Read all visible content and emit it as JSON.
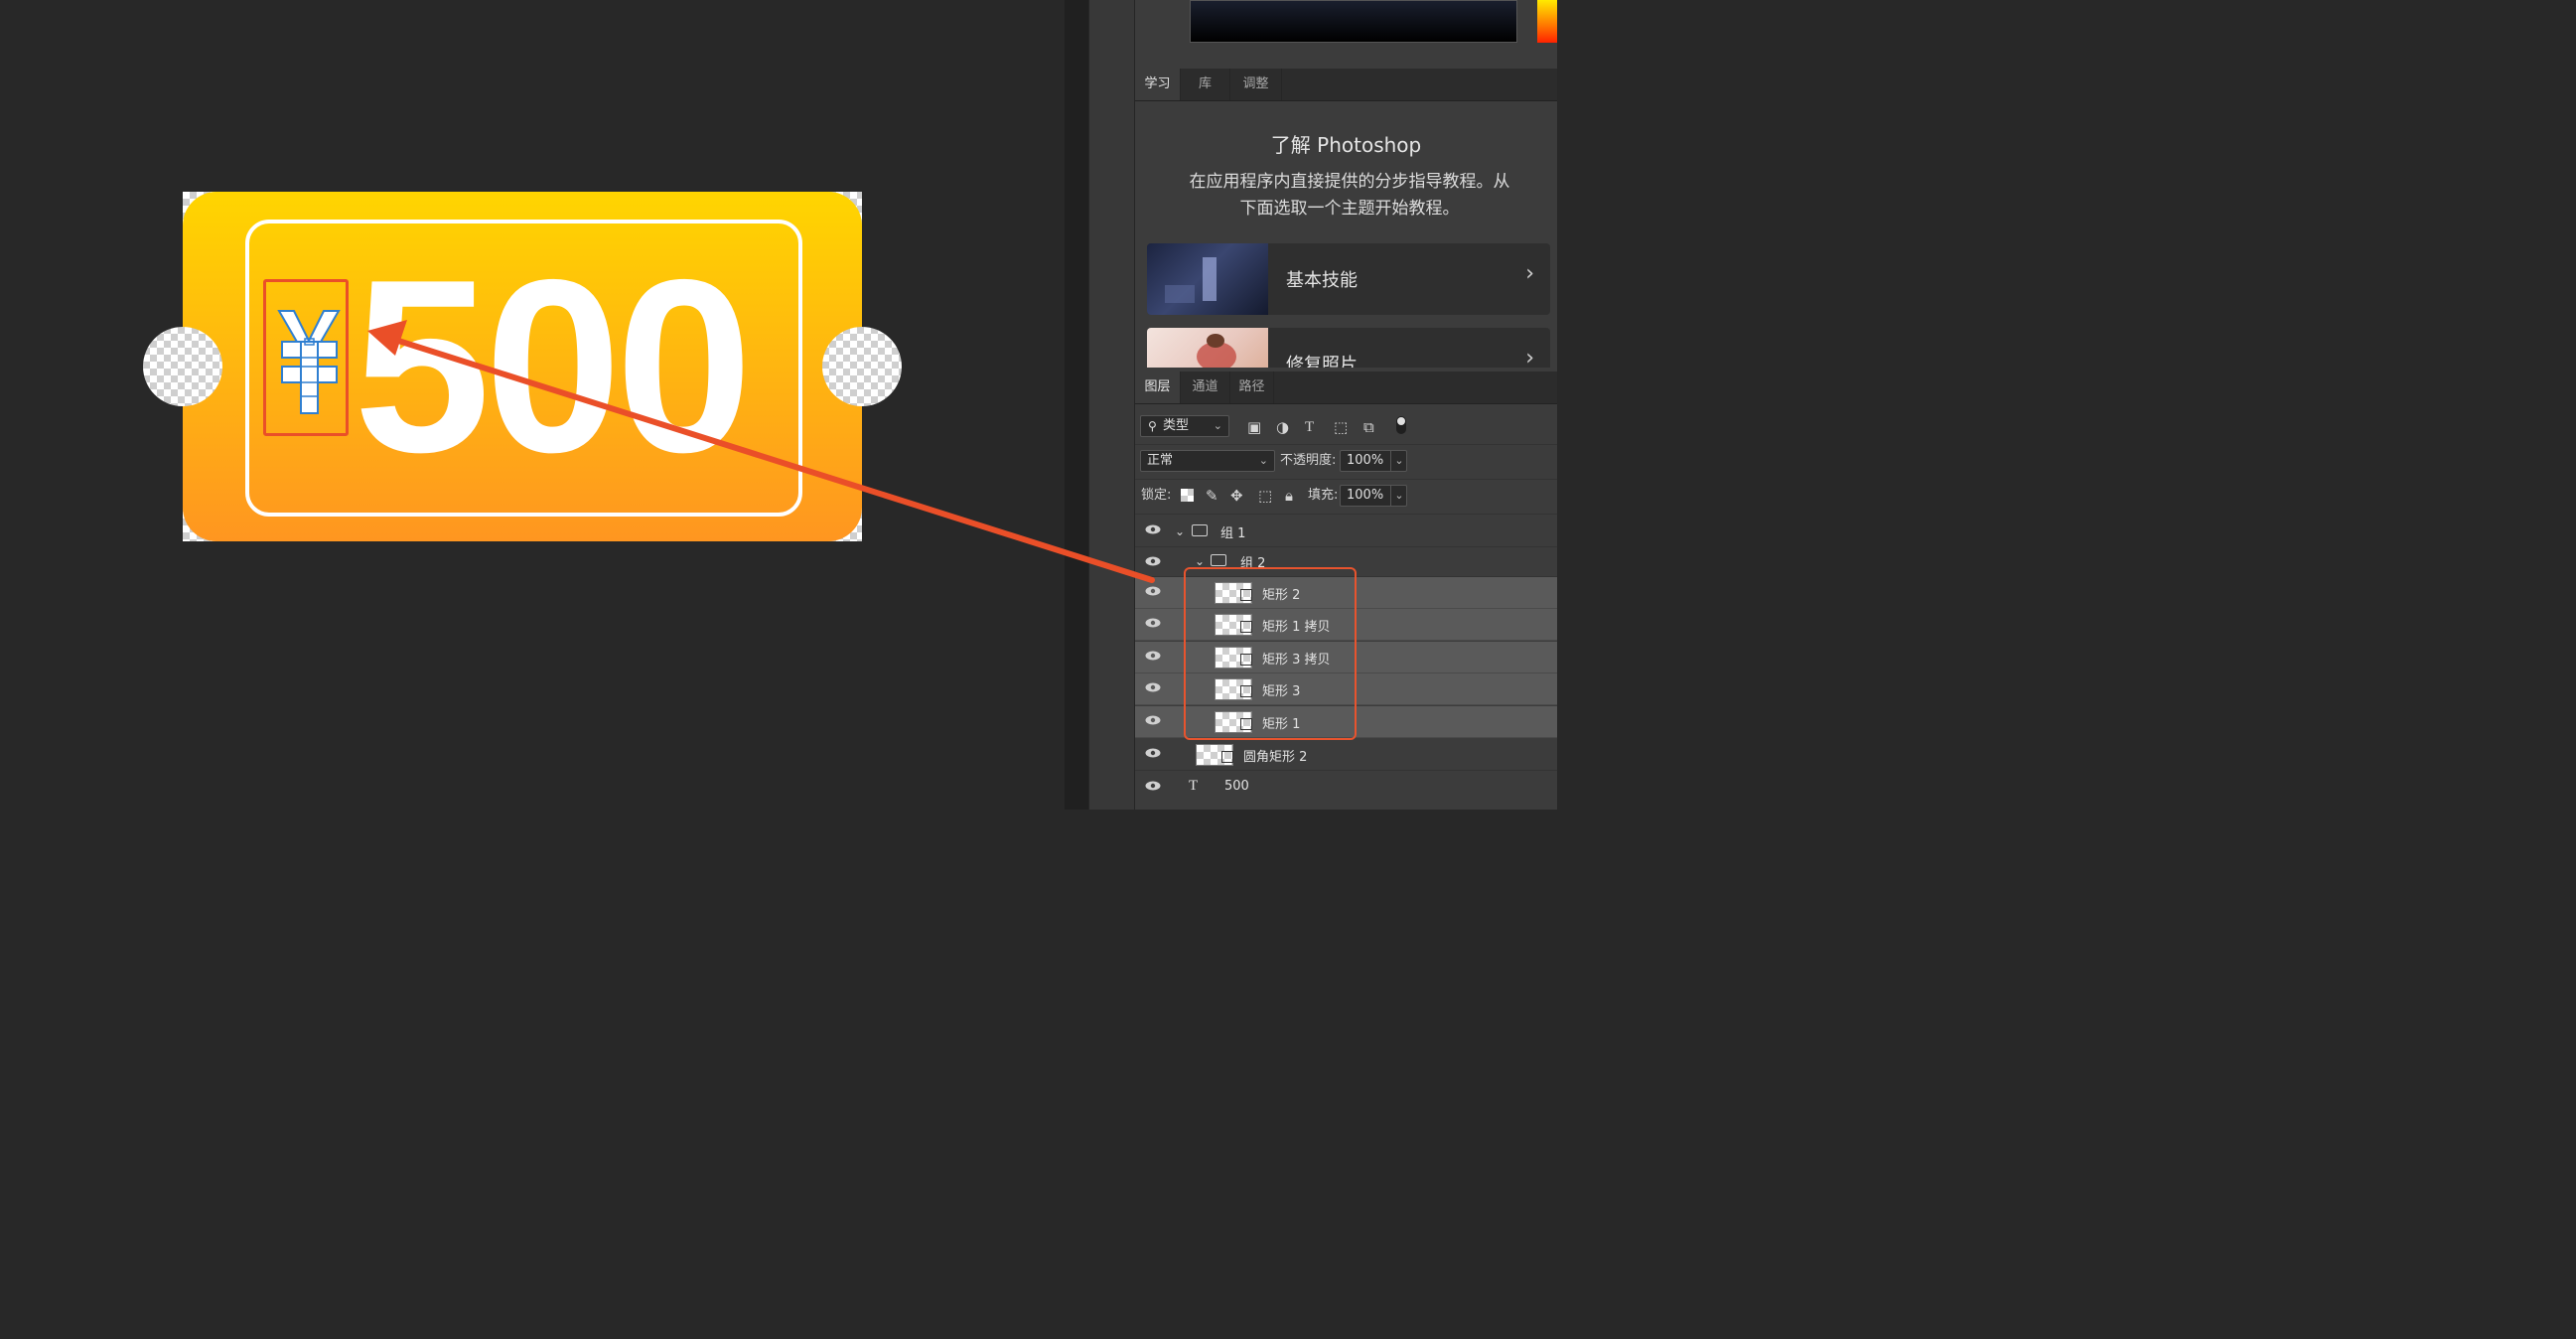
{
  "canvas": {
    "amount_text": "500",
    "ticket_colors": {
      "top": "#ffd500",
      "bottom": "#ff9620"
    },
    "annotation_color": "#e8542e"
  },
  "right_panel": {
    "learn_tabs": [
      "学习",
      "库",
      "调整"
    ],
    "learn_title": "了解 Photoshop",
    "learn_desc_line1": "在应用程序内直接提供的分步指导教程。从",
    "learn_desc_line2": "下面选取一个主题开始教程。",
    "lessons": [
      {
        "label": "基本技能",
        "chevron": "›"
      },
      {
        "label": "修复照片",
        "chevron": "›"
      }
    ],
    "layer_tabs": [
      "图层",
      "通道",
      "路径"
    ],
    "filter": {
      "label": "类型",
      "search_icon": "search-icon"
    },
    "filter_icons": [
      "image-filter-icon",
      "adjustment-filter-icon",
      "text-filter-icon",
      "shape-filter-icon",
      "smart-object-filter-icon"
    ],
    "blend_mode": "正常",
    "opacity_label": "不透明度:",
    "opacity_value": "100%",
    "lock_label": "锁定:",
    "fill_label": "填充:",
    "fill_value": "100%",
    "layers": [
      {
        "name": "组 1",
        "kind": "group"
      },
      {
        "name": "组 2",
        "kind": "group"
      },
      {
        "name": "矩形 2",
        "kind": "shape"
      },
      {
        "name": "矩形 1 拷贝",
        "kind": "shape"
      },
      {
        "name": "矩形 3 拷贝",
        "kind": "shape"
      },
      {
        "name": "矩形 3",
        "kind": "shape"
      },
      {
        "name": "矩形 1",
        "kind": "shape"
      },
      {
        "name": "圆角矩形 2",
        "kind": "shape"
      },
      {
        "name": "500",
        "kind": "text",
        "type_icon": "T"
      }
    ]
  }
}
